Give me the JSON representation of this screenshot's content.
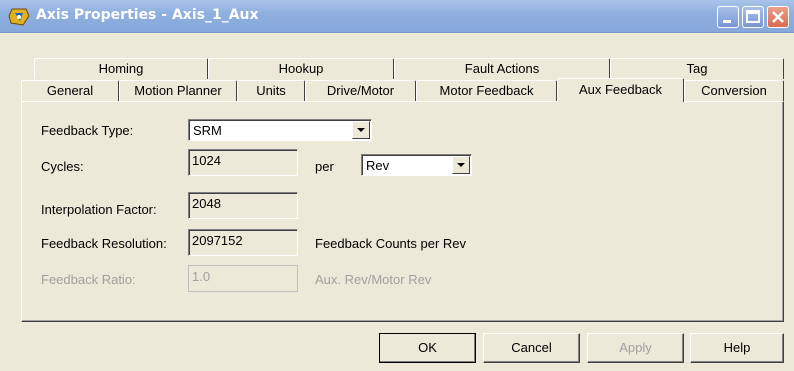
{
  "window": {
    "title": "Axis Properties - Axis_1_Aux",
    "icon": "axis-properties-icon",
    "controls": [
      "minimize-icon",
      "maximize-icon",
      "close-icon"
    ]
  },
  "tabs": {
    "back_row": [
      "Homing",
      "Hookup",
      "Fault Actions",
      "Tag"
    ],
    "front_row": [
      "General",
      "Motion Planner",
      "Units",
      "Drive/Motor",
      "Motor Feedback",
      "Aux Feedback",
      "Conversion"
    ],
    "active": "Aux Feedback"
  },
  "form": {
    "feedback_type": {
      "label": "Feedback Type:",
      "value": "SRM"
    },
    "cycles": {
      "label": "Cycles:",
      "value": "1024",
      "per_label": "per",
      "per_unit": "Rev"
    },
    "interpolation": {
      "label": "Interpolation Factor:",
      "value": "2048"
    },
    "resolution": {
      "label": "Feedback Resolution:",
      "value": "2097152",
      "unit": "Feedback Counts per Rev"
    },
    "ratio": {
      "label": "Feedback Ratio:",
      "value": "1.0",
      "unit": "Aux. Rev/Motor Rev"
    }
  },
  "buttons": {
    "ok": "OK",
    "cancel": "Cancel",
    "apply": "Apply",
    "help": "Help"
  },
  "colors": {
    "dialog_bg": "#ece9d8",
    "titlebar": "#8fb0e0",
    "disabled_text": "#a0a0a0"
  }
}
